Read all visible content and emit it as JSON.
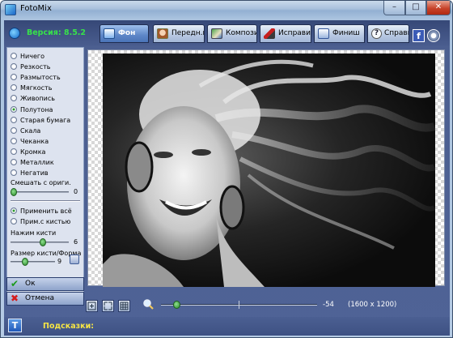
{
  "window": {
    "title": "FotoMix",
    "min_glyph": "–",
    "max_glyph": "□",
    "close_glyph": "✕"
  },
  "header": {
    "version": "Версия: 8.5.2",
    "tabs": [
      {
        "label": "Фон",
        "icon": "background-icon",
        "active": true
      },
      {
        "label": "Передн.п",
        "icon": "portrait-icon",
        "active": false
      },
      {
        "label": "Компози",
        "icon": "compose-icon",
        "active": false
      },
      {
        "label": "Исправи",
        "icon": "brush-icon",
        "active": false
      },
      {
        "label": "Финиш",
        "icon": "finish-icon",
        "active": false
      },
      {
        "label": "Справка",
        "icon": "help-icon",
        "active": false
      }
    ],
    "help_glyph": "?",
    "facebook_glyph": "f"
  },
  "effects": {
    "items": [
      "Ничего",
      "Резкость",
      "Размытость",
      "Мягкость",
      "Живопись",
      "Полутона",
      "Старая бумага",
      "Скала",
      "Чеканка",
      "Кромка",
      "Металлик",
      "Негатив"
    ],
    "selected": "Полутона"
  },
  "blend": {
    "label": "Смешать с ориги.",
    "value": "0",
    "level": 0
  },
  "apply": {
    "options": [
      "Применить всё",
      "Прим.с кистью"
    ],
    "selected": "Применить всё"
  },
  "brush_pressure": {
    "label": "Нажим кисти",
    "value": "6",
    "level": 0.6
  },
  "brush_size": {
    "label": "Размер кисти/Форма",
    "value": "9",
    "level": 0.3
  },
  "buttons": {
    "ok": "Ок",
    "cancel": "Отмена",
    "ok_glyph": "✔",
    "cancel_glyph": "✖"
  },
  "zoom": {
    "value": "-54",
    "level": 0.08
  },
  "image_size": "(1600 x 1200)",
  "status": {
    "hint_label": "Подсказки:",
    "t_glyph": "T"
  },
  "colors": {
    "version_green": "#37e24a",
    "hint_yellow": "#f6e544",
    "active_tab": "#4b74b8"
  }
}
